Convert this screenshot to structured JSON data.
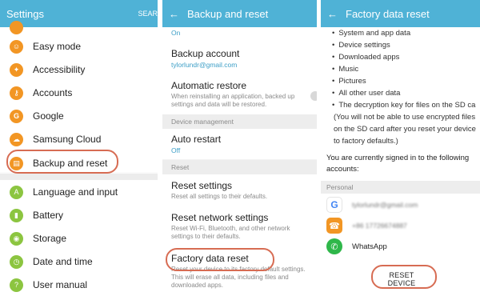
{
  "panel1": {
    "title": "Settings",
    "search_label": "SEAR",
    "items": [
      {
        "label": "Easy mode",
        "icon": "smile-icon",
        "color": "#f29624"
      },
      {
        "label": "Accessibility",
        "icon": "person-icon",
        "color": "#f29624"
      },
      {
        "label": "Accounts",
        "icon": "key-icon",
        "color": "#f29624"
      },
      {
        "label": "Google",
        "icon": "google-icon",
        "color": "#f29624"
      },
      {
        "label": "Samsung Cloud",
        "icon": "cloud-icon",
        "color": "#f29624"
      },
      {
        "label": "Backup and reset",
        "icon": "backup-icon",
        "color": "#f29624"
      },
      {
        "label": "Language and input",
        "icon": "language-icon",
        "color": "#8cc540"
      },
      {
        "label": "Battery",
        "icon": "battery-icon",
        "color": "#8cc540"
      },
      {
        "label": "Storage",
        "icon": "storage-icon",
        "color": "#8cc540"
      },
      {
        "label": "Date and time",
        "icon": "clock-icon",
        "color": "#8cc540"
      },
      {
        "label": "User manual",
        "icon": "manual-icon",
        "color": "#8cc540"
      }
    ]
  },
  "panel2": {
    "title": "Backup and reset",
    "top_partial": "On",
    "backup_account": {
      "title": "Backup account",
      "sub": "tylorlundr@gmail.com"
    },
    "auto_restore": {
      "title": "Automatic restore",
      "sub": "When reinstalling an application, backed up settings and data will be restored."
    },
    "section_device": "Device management",
    "auto_restart": {
      "title": "Auto restart",
      "sub": "Off"
    },
    "section_reset": "Reset",
    "reset_settings": {
      "title": "Reset settings",
      "sub": "Reset all settings to their defaults."
    },
    "reset_network": {
      "title": "Reset network settings",
      "sub": "Reset Wi-Fi, Bluetooth, and other network settings to their defaults."
    },
    "factory_reset": {
      "title": "Factory data reset",
      "sub": "Reset your device to its factory default settings. This will erase all data, including files and downloaded apps."
    }
  },
  "panel3": {
    "title": "Factory data reset",
    "bullets": [
      "System and app data",
      "Device settings",
      "Downloaded apps",
      "Music",
      "Pictures",
      "All other user data",
      "The decryption key for files on the SD ca"
    ],
    "note_lines": [
      "(You will not be able to use encrypted files",
      "on the SD card after you reset your device",
      "to factory defaults.)"
    ],
    "signed_in_lines": [
      "You are currently signed in to the following",
      "accounts:"
    ],
    "section_personal": "Personal",
    "accounts": [
      {
        "label": "tylorlundr@gmail.com",
        "icon": "google-icon"
      },
      {
        "label": "+86 17726674887",
        "icon": "contact-icon"
      },
      {
        "label": "WhatsApp",
        "icon": "whatsapp-icon"
      }
    ],
    "reset_button": "RESET DEVICE"
  },
  "colors": {
    "appbar": "#4fb2d6",
    "highlight": "#d76c53"
  }
}
